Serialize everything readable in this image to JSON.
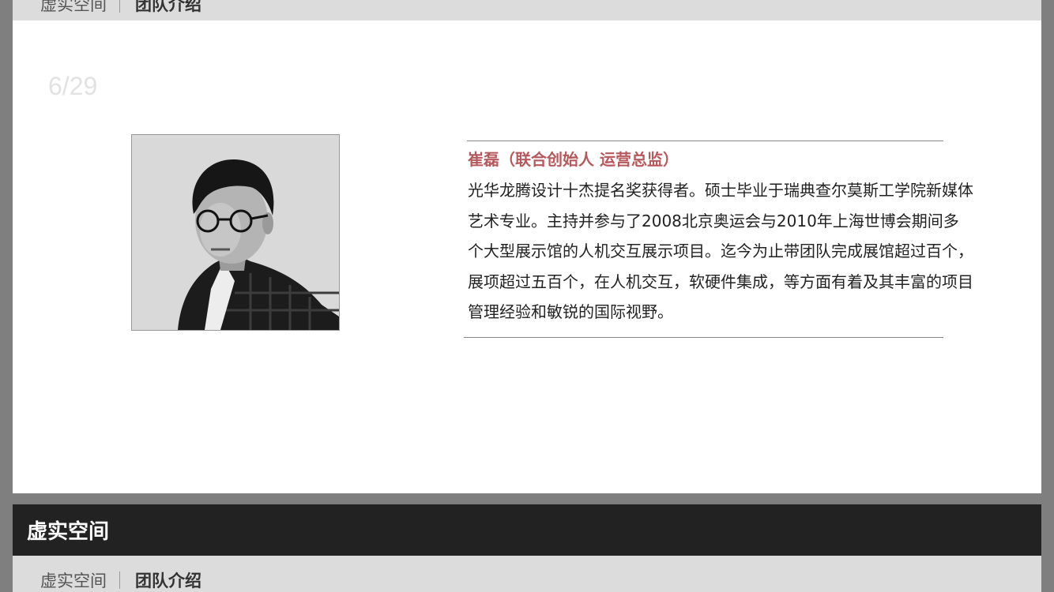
{
  "top_breadcrumb": {
    "home": "虚实空间",
    "current": "团队介绍"
  },
  "slide": {
    "page_indicator": "6/29",
    "photo_icon": "portrait-photo",
    "person": {
      "name_title": "崔磊（联合创始人  运营总监）",
      "bio": "光华龙腾设计十杰提名奖获得者。硕士毕业于瑞典查尔莫斯工学院新媒体艺术专业。主持并参与了2008北京奥运会与2010年上海世博会期间多个大型展示馆的人机交互展示项目。迄今为止带团队完成展馆超过百个，展项超过五百个，在人机交互，软硬件集成，等方面有着及其丰富的项目管理经验和敏锐的国际视野。"
    }
  },
  "section_header": {
    "title": "虚实空间"
  },
  "bottom_breadcrumb": {
    "home": "虚实空间",
    "current": "团队介绍"
  },
  "colors": {
    "accent_name": "#b5595d",
    "page_background": "#7f7f7f",
    "header_background": "#222222",
    "breadcrumb_background": "#dcdcdc"
  }
}
